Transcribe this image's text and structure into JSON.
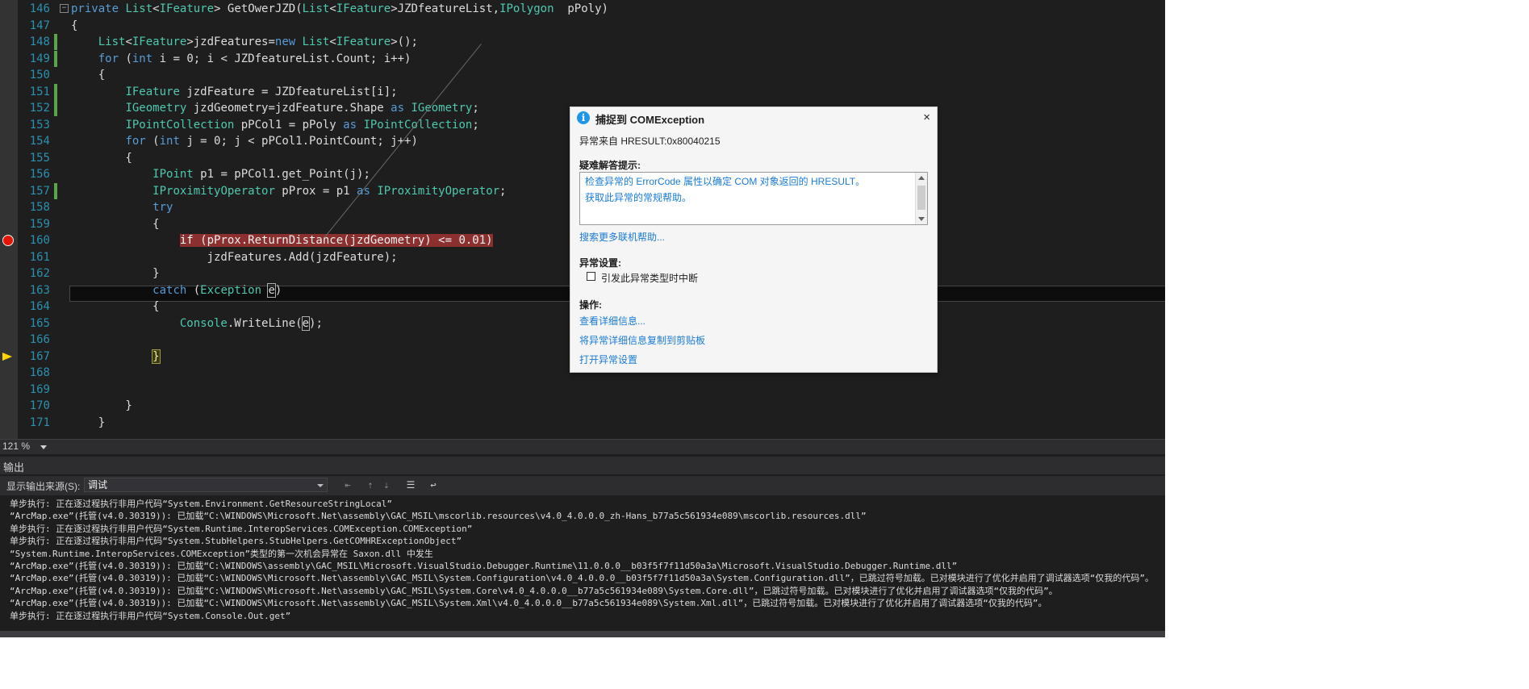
{
  "editor": {
    "lines": [
      {
        "n": "146",
        "html": "<span class=\"kw\">private</span> <span class=\"ty\">List</span>&lt;<span class=\"ty\">IFeature</span>&gt; GetOwerJZD(<span class=\"ty\">List</span>&lt;<span class=\"ty\">IFeature</span>&gt;JZDfeatureList,<span class=\"ty\">IPolygon</span>  pPoly)"
      },
      {
        "n": "147",
        "html": "{"
      },
      {
        "n": "148",
        "html": "    <span class=\"ty\">List</span>&lt;<span class=\"ty\">IFeature</span>&gt;jzdFeatures=<span class=\"kw\">new</span> <span class=\"ty\">List</span>&lt;<span class=\"ty\">IFeature</span>&gt;();"
      },
      {
        "n": "149",
        "html": "    <span class=\"kw\">for</span> (<span class=\"kw\">int</span> i = 0; i &lt; JZDfeatureList.Count; i++)"
      },
      {
        "n": "150",
        "html": "    {"
      },
      {
        "n": "151",
        "html": "        <span class=\"ty\">IFeature</span> jzdFeature = JZDfeatureList[i];"
      },
      {
        "n": "152",
        "html": "        <span class=\"ty\">IGeometry</span> jzdGeometry=jzdFeature.Shape <span class=\"kw\">as</span> <span class=\"ty\">IGeometry</span>;"
      },
      {
        "n": "153",
        "html": "        <span class=\"ty\">IPointCollection</span> pPCo− = pPoly <span class=\"kw\">as</span> <span class=\"ty\">IPointCollection</span>;"
      },
      {
        "n": "154",
        "html": "        <span class=\"kw\">for</span> (<span class=\"kw\">int</span> j = 0; j &lt; pPCol1.PointCount; j++)"
      },
      {
        "n": "155",
        "html": "        {"
      },
      {
        "n": "156",
        "html": "            <span class=\"ty\">IPoint</span> p1 = pPCol1.get_Point(j);"
      },
      {
        "n": "157",
        "html": "            <span class=\"ty\">IProximityOperator</span> pProx = p1 <span class=\"kw\">as</span> <span class=\"ty\">IProximityOperator</span>;"
      },
      {
        "n": "158",
        "html": "            <span class=\"kw\">try</span>"
      },
      {
        "n": "159",
        "html": "            {"
      },
      {
        "n": "160",
        "html": "                <span class=\"bp-hl\"><span class=\"kw\">if</span> (pProx.ReturnDistance(jzdGeometry) &lt;= 0.01)</span>"
      },
      {
        "n": "161",
        "html": "                    jzdFeatures.Add(jzdFeature);"
      },
      {
        "n": "162",
        "html": "            }"
      },
      {
        "n": "163",
        "html": "            <span class=\"kw\">catch</span> (<span class=\"ty\">Exception</span> <span class=\"hl-e\">e</span>)"
      },
      {
        "n": "164",
        "html": "            {"
      },
      {
        "n": "165",
        "html": "                <span class=\"ty\">Console</span>.WriteLine(<span class=\"hl-e\">e</span>);"
      },
      {
        "n": "166",
        "html": ""
      },
      {
        "n": "167",
        "html": "            <span class=\"yel-brace\">}</span>"
      },
      {
        "n": "168",
        "html": ""
      },
      {
        "n": "169",
        "html": ""
      },
      {
        "n": "170",
        "html": "        }"
      },
      {
        "n": "171",
        "html": "    }"
      }
    ],
    "zoom": "121 %"
  },
  "output": {
    "title": "输出",
    "source_label": "显示输出来源(S):",
    "source_value": "调试",
    "lines": [
      "单步执行: 正在逐过程执行非用户代码“System.Environment.GetResourceStringLocal”",
      "“ArcMap.exe”(托管(v4.0.30319)): 已加载“C:\\WINDOWS\\Microsoft.Net\\assembly\\GAC_MSIL\\mscorlib.resources\\v4.0_4.0.0.0_zh-Hans_b77a5c561934e089\\mscorlib.resources.dll”",
      "单步执行: 正在逐过程执行非用户代码“System.Runtime.InteropServices.COMException.COMException”",
      "单步执行: 正在逐过程执行非用户代码“System.StubHelpers.StubHelpers.GetCOMHRExceptionObject”",
      "“System.Runtime.InteropServices.COMException”类型的第一次机会异常在 Saxon.dll 中发生",
      "“ArcMap.exe”(托管(v4.0.30319)): 已加载“C:\\WINDOWS\\assembly\\GAC_MSIL\\Microsoft.VisualStudio.Debugger.Runtime\\11.0.0.0__b03f5f7f11d50a3a\\Microsoft.VisualStudio.Debugger.Runtime.dll”",
      "“ArcMap.exe”(托管(v4.0.30319)): 已加载“C:\\WINDOWS\\Microsoft.Net\\assembly\\GAC_MSIL\\System.Configuration\\v4.0_4.0.0.0__b03f5f7f11d50a3a\\System.Configuration.dll”，已跳过符号加载。已对模块进行了优化并启用了调试器选项“仅我的代码”。",
      "“ArcMap.exe”(托管(v4.0.30319)): 已加载“C:\\WINDOWS\\Microsoft.Net\\assembly\\GAC_MSIL\\System.Core\\v4.0_4.0.0.0__b77a5c561934e089\\System.Core.dll”，已跳过符号加载。已对模块进行了优化并启用了调试器选项“仅我的代码”。",
      "“ArcMap.exe”(托管(v4.0.30319)): 已加载“C:\\WINDOWS\\Microsoft.Net\\assembly\\GAC_MSIL\\System.Xml\\v4.0_4.0.0.0__b77a5c561934e089\\System.Xml.dll”，已跳过符号加载。已对模块进行了优化并启用了调试器选项“仅我的代码”。",
      "单步执行: 正在逐过程执行非用户代码“System.Console.Out.get”"
    ]
  },
  "exception": {
    "title": "捕捉到 COMException",
    "close": "×",
    "message": "异常来自 HRESULT:0x80040215",
    "tips_heading": "疑难解答提示:",
    "tips": [
      "检查异常的 ErrorCode 属性以确定 COM 对象返回的 HRESULT。",
      "获取此异常的常规帮助。"
    ],
    "more_help": "搜索更多联机帮助...",
    "settings_heading": "异常设置:",
    "break_label": "引发此异常类型时中断",
    "actions_heading": "操作:",
    "actions": [
      "查看详细信息...",
      "将异常详细信息复制到剪贴板",
      "打开异常设置"
    ]
  }
}
